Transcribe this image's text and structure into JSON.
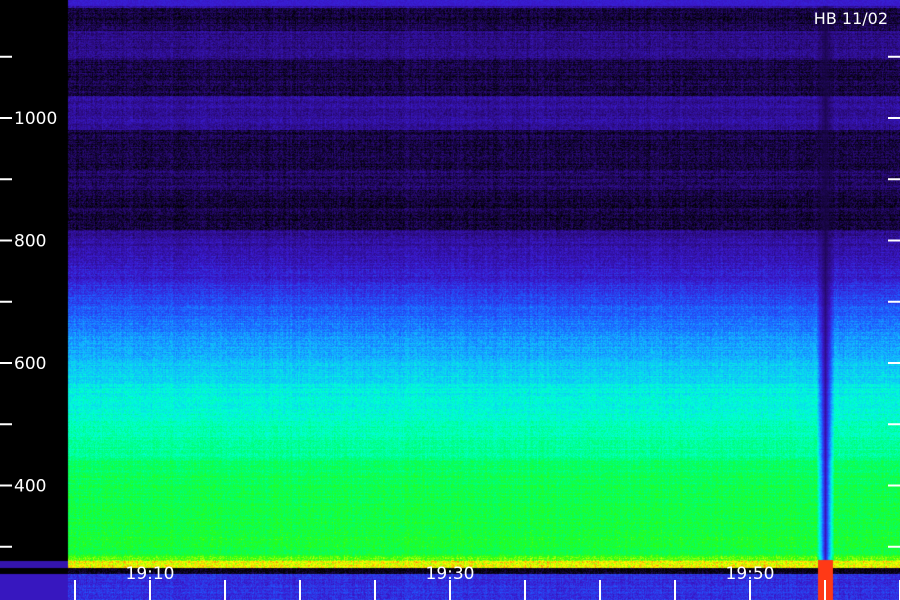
{
  "chart_data": {
    "type": "heatmap",
    "title": "HB 11/02",
    "xlabel": "",
    "ylabel": "",
    "y_ticks": [
      1000,
      800,
      600,
      400
    ],
    "y_range": [
      240,
      1200
    ],
    "x_tick_labels": [
      "19:10",
      "19:30",
      "19:50"
    ],
    "x_time_range": [
      "19:04",
      "20:03"
    ],
    "colorscale": [
      "#000000",
      "#2a0a7a",
      "#3a1ad0",
      "#1e5cff",
      "#12b8ff",
      "#00ffd8",
      "#00ff70",
      "#2bff10",
      "#ffff00",
      "#ff1a1a"
    ],
    "features": [
      {
        "label": "dark vertical gap",
        "time": "19:55",
        "y_min": 240,
        "y_max": 1140
      },
      {
        "label": "bright red burst",
        "time": "19:55",
        "y_min": 240,
        "y_max": 300
      }
    ],
    "grid": false,
    "legend": "none"
  }
}
